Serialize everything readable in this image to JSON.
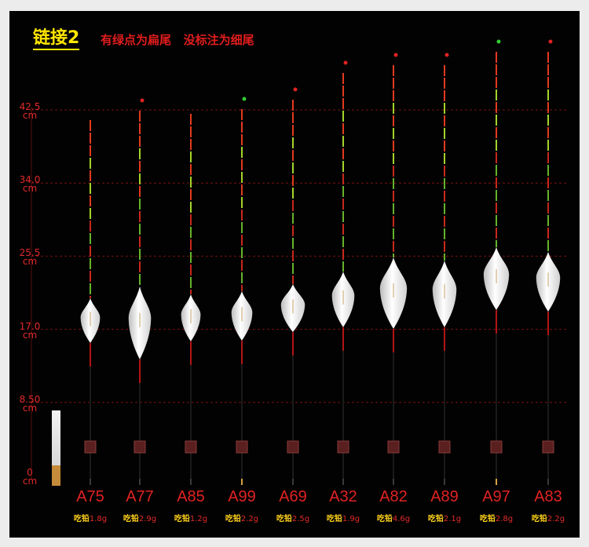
{
  "header": {
    "title": "链接2",
    "note": "有绿点为扁尾   没标注为细尾"
  },
  "axis": {
    "unit": "cm",
    "ticks": [
      {
        "value": 42.5,
        "label": "42.5"
      },
      {
        "value": 34.0,
        "label": "34.0"
      },
      {
        "value": 25.5,
        "label": "25.5"
      },
      {
        "value": 17.0,
        "label": "17.0"
      },
      {
        "value": 8.5,
        "label": "8.50"
      },
      {
        "value": 0,
        "label": "0"
      }
    ]
  },
  "weight_label": "吃铅",
  "colors": {
    "background": "#020202",
    "accent_red": "#e12222",
    "title_yellow": "#ffe600",
    "tip_green": "#33cc33"
  },
  "floats": [
    {
      "model": "A75",
      "weight": "1.8g",
      "tip_dot": "none"
    },
    {
      "model": "A77",
      "weight": "2.9g",
      "tip_dot": "red"
    },
    {
      "model": "A85",
      "weight": "1.2g",
      "tip_dot": "none"
    },
    {
      "model": "A99",
      "weight": "2.2g",
      "tip_dot": "green"
    },
    {
      "model": "A69",
      "weight": "2.5g",
      "tip_dot": "red"
    },
    {
      "model": "A32",
      "weight": "1.9g",
      "tip_dot": "red"
    },
    {
      "model": "A82",
      "weight": "4.6g",
      "tip_dot": "red"
    },
    {
      "model": "A89",
      "weight": "2.1g",
      "tip_dot": "red"
    },
    {
      "model": "A97",
      "weight": "2.8g",
      "tip_dot": "green"
    },
    {
      "model": "A83",
      "weight": "2.2g",
      "tip_dot": "red"
    }
  ]
}
